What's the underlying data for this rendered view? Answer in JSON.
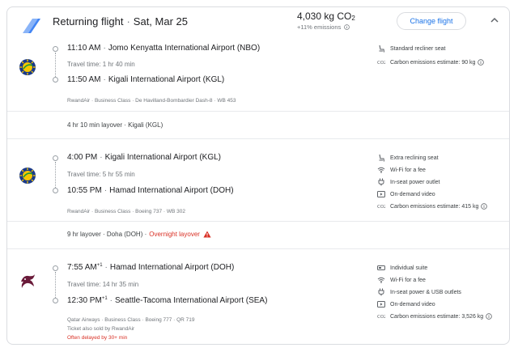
{
  "header": {
    "title": "Returning flight",
    "date": "Sat, Mar 25",
    "emissions": "4,030 kg CO",
    "emissions_sub": "2",
    "emissions_delta": "+11% emissions",
    "change_label": "Change flight",
    "accent": "#1a73e8"
  },
  "segments": [
    {
      "airline_logo": "rwandair-logo",
      "depart_time": "11:10 AM",
      "depart_airport": "Jomo Kenyatta International Airport (NBO)",
      "travel_time": "Travel time: 1 hr 40 min",
      "arrive_time": "11:50 AM",
      "arrive_airport": "Kigali International Airport (KGL)",
      "details": "RwandAir · Business Class · De Havilland-Bombardier Dash-8 · WB 453",
      "amenities": [
        {
          "icon": "seat-icon",
          "label": "Standard recliner seat"
        },
        {
          "icon": "co2-icon",
          "label": "Carbon emissions estimate: 90 kg"
        }
      ]
    },
    {
      "airline_logo": "rwandair-logo",
      "depart_time": "4:00 PM",
      "depart_airport": "Kigali International Airport (KGL)",
      "travel_time": "Travel time: 5 hr 55 min",
      "arrive_time": "10:55 PM",
      "arrive_airport": "Hamad International Airport (DOH)",
      "details": "RwandAir · Business Class · Boeing 737 · WB 302",
      "amenities": [
        {
          "icon": "seat-icon",
          "label": "Extra reclining seat"
        },
        {
          "icon": "wifi-icon",
          "label": "Wi-Fi for a fee"
        },
        {
          "icon": "power-icon",
          "label": "In-seat power outlet"
        },
        {
          "icon": "video-icon",
          "label": "On-demand video"
        },
        {
          "icon": "co2-icon",
          "label": "Carbon emissions estimate: 415 kg"
        }
      ]
    },
    {
      "airline_logo": "qatar-airways-logo",
      "depart_time": "7:55 AM",
      "depart_sup": "+1",
      "depart_airport": "Hamad International Airport (DOH)",
      "travel_time": "Travel time: 14 hr 35 min",
      "arrive_time": "12:30 PM",
      "arrive_sup": "+1",
      "arrive_airport": "Seattle-Tacoma International Airport (SEA)",
      "details": "Qatar Airways · Business Class · Boeing 777 · QR 719",
      "details2": "Ticket also sold by RwandAir",
      "delay": "Often delayed by 30+ min",
      "amenities": [
        {
          "icon": "suite-icon",
          "label": "Individual suite"
        },
        {
          "icon": "wifi-icon",
          "label": "Wi-Fi for a fee"
        },
        {
          "icon": "power-icon",
          "label": "In-seat power & USB outlets"
        },
        {
          "icon": "video-icon",
          "label": "On-demand video"
        },
        {
          "icon": "co2-icon",
          "label": "Carbon emissions estimate: 3,526 kg"
        }
      ]
    }
  ],
  "layovers": [
    {
      "text": "4 hr 10 min layover · Kigali (KGL)"
    },
    {
      "text": "9 hr layover · Doha (DOH) · ",
      "warning": "Overnight layover"
    }
  ]
}
